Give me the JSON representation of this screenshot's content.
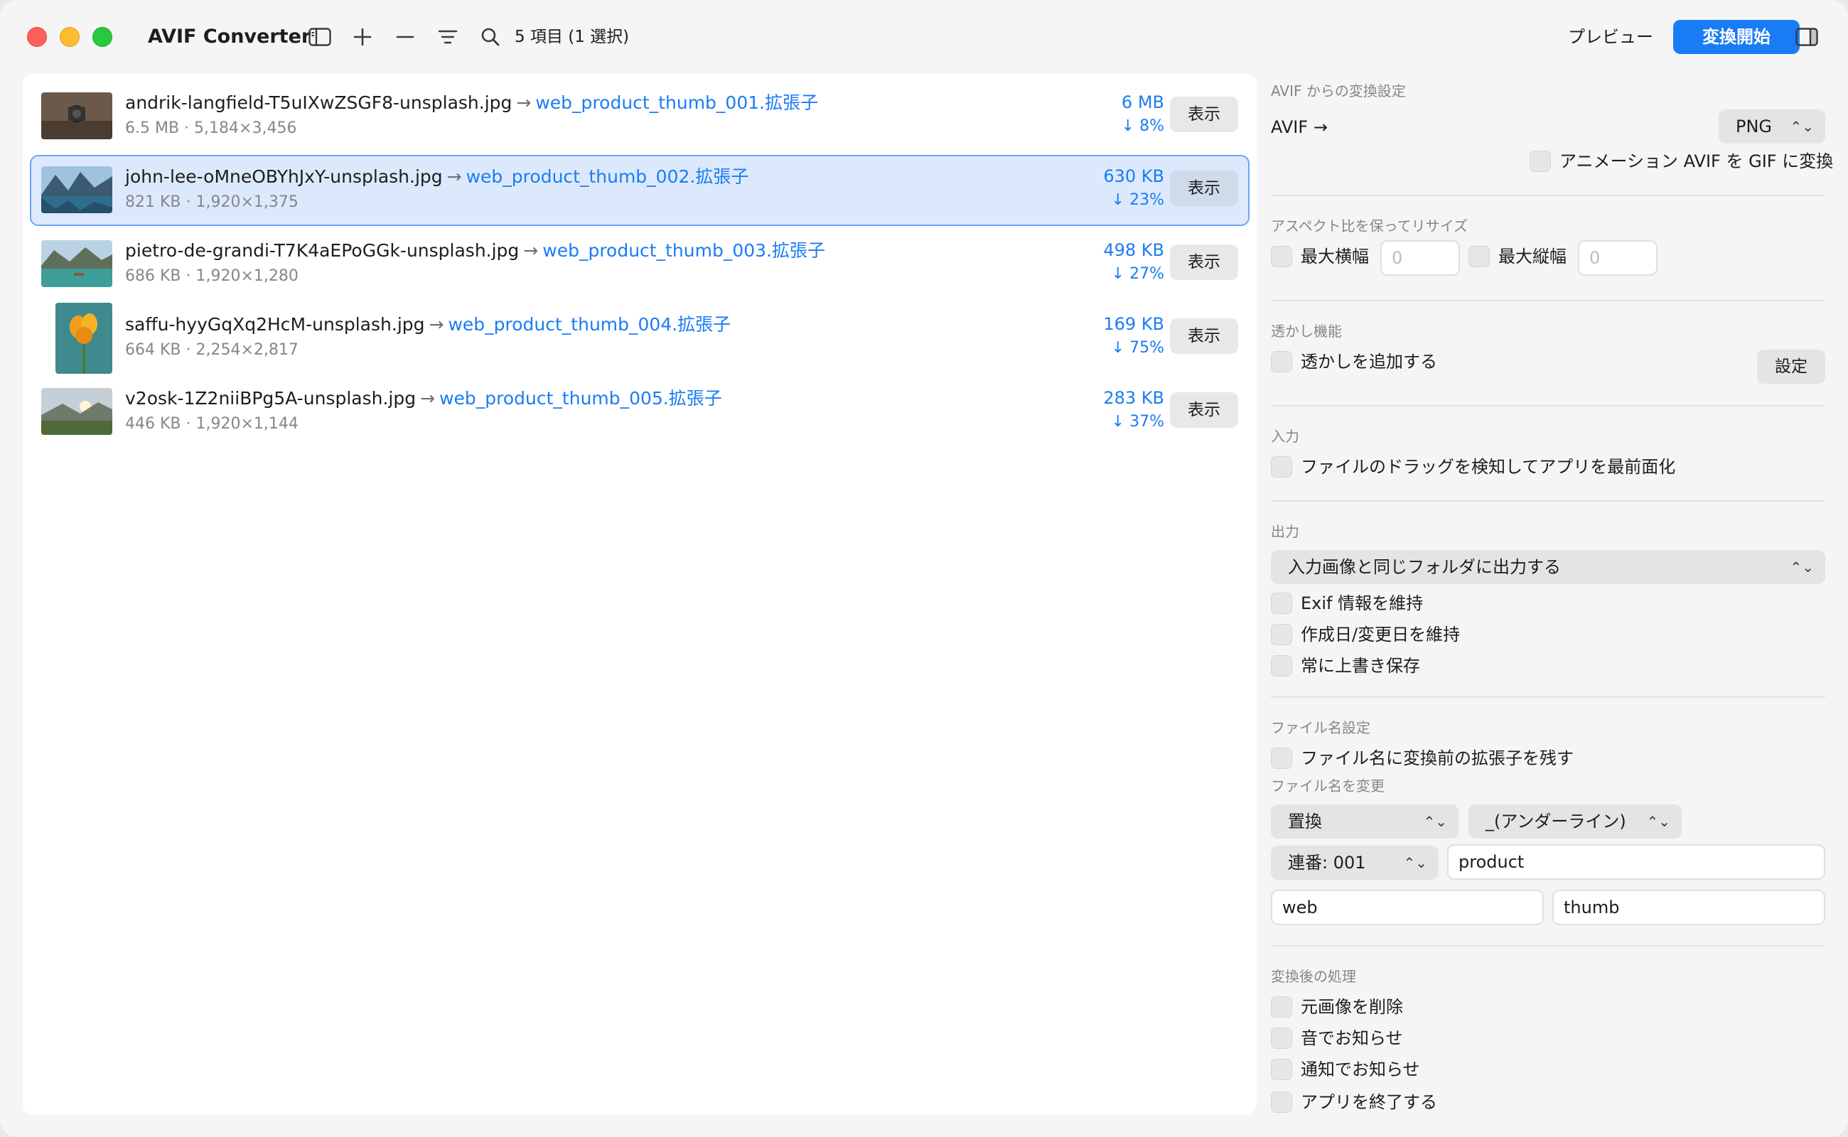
{
  "app": {
    "title": "AVIF Converter",
    "selection_count": "5 項目 (1 選択)",
    "preview_label": "プレビュー",
    "convert_label": "変換開始"
  },
  "files": [
    {
      "name": "andrik-langfield-T5uIXwZSGF8-unsplash.jpg",
      "output": "web_product_thumb_001.拡張子",
      "meta": "6.5 MB · 5,184×3,456",
      "size": "6 MB",
      "reduction": "↓ 8%",
      "button": "表示",
      "selected": false
    },
    {
      "name": "john-lee-oMneOBYhJxY-unsplash.jpg",
      "output": "web_product_thumb_002.拡張子",
      "meta": "821 KB · 1,920×1,375",
      "size": "630 KB",
      "reduction": "↓ 23%",
      "button": "表示",
      "selected": true
    },
    {
      "name": "pietro-de-grandi-T7K4aEPoGGk-unsplash.jpg",
      "output": "web_product_thumb_003.拡張子",
      "meta": "686 KB · 1,920×1,280",
      "size": "498 KB",
      "reduction": "↓ 27%",
      "button": "表示",
      "selected": false
    },
    {
      "name": "saffu-hyyGqXq2HcM-unsplash.jpg",
      "output": "web_product_thumb_004.拡張子",
      "meta": "664 KB · 2,254×2,817",
      "size": "169 KB",
      "reduction": "↓ 75%",
      "button": "表示",
      "selected": false
    },
    {
      "name": "v2osk-1Z2niiBPg5A-unsplash.jpg",
      "output": "web_product_thumb_005.拡張子",
      "meta": "446 KB · 1,920×1,144",
      "size": "283 KB",
      "reduction": "↓ 37%",
      "button": "表示",
      "selected": false
    }
  ],
  "settings": {
    "conversion": {
      "title": "AVIF からの変換設定",
      "source": "AVIF  →",
      "format": "PNG",
      "anim_gif": "アニメーション AVIF を GIF に変換"
    },
    "resize": {
      "title": "アスペクト比を保ってリサイズ",
      "max_width": "最大横幅",
      "max_height": "最大縦幅",
      "width_placeholder": "0",
      "height_placeholder": "0"
    },
    "watermark": {
      "title": "透かし機能",
      "add": "透かしを追加する",
      "settings_button": "設定"
    },
    "input": {
      "title": "入力",
      "detect_drag": "ファイルのドラッグを検知してアプリを最前面化"
    },
    "output": {
      "title": "出力",
      "folder": "入力画像と同じフォルダに出力する",
      "keep_exif": "Exif 情報を維持",
      "keep_dates": "作成日/変更日を維持",
      "overwrite": "常に上書き保存"
    },
    "filename": {
      "title": "ファイル名設定",
      "keep_ext": "ファイル名に変換前の拡張子を残す",
      "rename_title": "ファイル名を変更",
      "mode": "置換",
      "separator": "_(アンダーライン)",
      "sequence": "連番: 001",
      "field1": "product",
      "field2": "web",
      "field3": "thumb"
    },
    "post": {
      "title": "変換後の処理",
      "delete_original": "元画像を削除",
      "sound": "音でお知らせ",
      "notify": "通知でお知らせ",
      "quit": "アプリを終了する"
    }
  }
}
